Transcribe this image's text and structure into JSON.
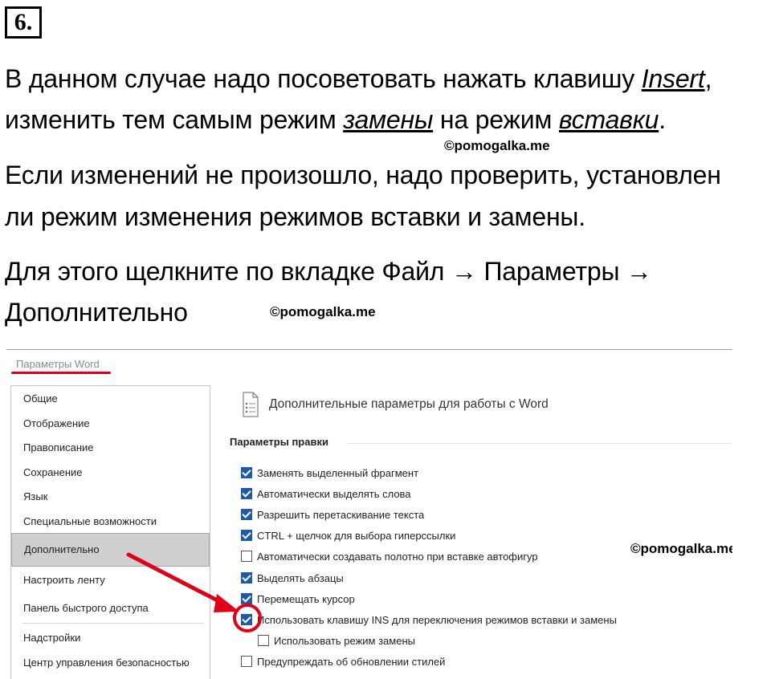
{
  "task": {
    "number": "6."
  },
  "text": {
    "p1_a": "В данном случае надо посоветовать нажать клавишу ",
    "p1_key": "Insert",
    "p1_b": ",",
    "p2_a": "изменить тем самым режим ",
    "p2_mode1": "замены",
    "p2_b": " на режим ",
    "p2_mode2": "вставки",
    "p2_c": ".",
    "p3": "Если изменений не произошло, надо проверить, установлен",
    "p4": "ли режим изменения режимов вставки и замены.",
    "p5": "Для этого щелкните по вкладке Файл → Параметры →",
    "p6": "Дополнительно"
  },
  "watermarks": {
    "w1": "©pomogalka.me",
    "w2": "©pomogalka.me",
    "w3": "©pomogalka.me"
  },
  "dialog": {
    "title": "Параметры Word",
    "sidebar": [
      "Общие",
      "Отображение",
      "Правописание",
      "Сохранение",
      "Язык",
      "Специальные возможности",
      "Дополнительно",
      "Настроить ленту",
      "Панель быстрого доступа",
      "Надстройки",
      "Центр управления безопасностью"
    ],
    "selected_item": "Дополнительно",
    "heading": "Дополнительные параметры для работы с Word",
    "section": "Параметры правки",
    "options": [
      {
        "label": "Заменять выделенный фрагмент",
        "checked": true
      },
      {
        "label": "Автоматически выделять слова",
        "checked": true
      },
      {
        "label": "Разрешить перетаскивание текста",
        "checked": true
      },
      {
        "label": "CTRL + щелчок для выбора гиперссылки",
        "checked": true
      },
      {
        "label": "Автоматически создавать полотно при вставке автофигур",
        "checked": false
      },
      {
        "label": "Выделять абзацы",
        "checked": true
      },
      {
        "label": "Перемещать курсор",
        "checked": true
      },
      {
        "label": "Использовать клавишу INS для переключения режимов вставки и замены",
        "checked": true
      },
      {
        "label": "Использовать режим замены",
        "checked": false
      },
      {
        "label": "Предупреждать об обновлении стилей",
        "checked": false
      }
    ],
    "accent_color": "#1f5aa6",
    "highlight_color": "#e0001a"
  }
}
